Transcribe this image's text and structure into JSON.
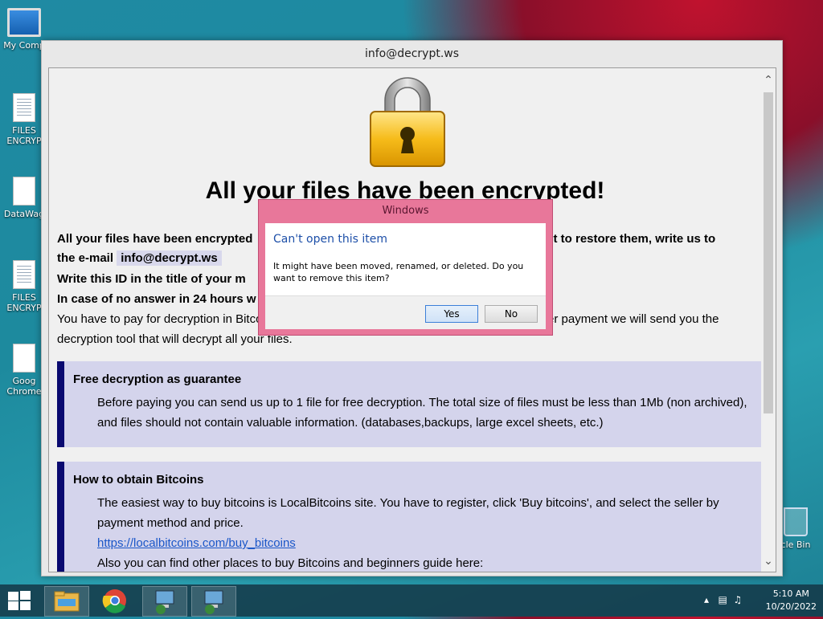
{
  "desktop": {
    "icons": [
      {
        "label": "My Comp"
      },
      {
        "label": "FILES ENCRYP"
      },
      {
        "label": "DataWag"
      },
      {
        "label": "FILES ENCRYP"
      },
      {
        "label": "Goog Chrome"
      }
    ],
    "recycle_bin": "cle Bin"
  },
  "window": {
    "title": "info@decrypt.ws",
    "headline": "All your files have been encrypted!",
    "line1_start": "All your files have been encrypted",
    "line1_end": "ant to restore them, write us to",
    "line2_prefix": "the e-mail",
    "email": "info@decrypt.ws",
    "line3": "Write this ID in the title of your m",
    "line4": "In case of no answer in 24 hours w",
    "line5_start": "You have to pay for decryption in Bitco",
    "line5_end": "er payment we will send you the",
    "line6": "decryption tool that will decrypt all your files.",
    "box1": {
      "title": "Free decryption as guarantee",
      "text": "Before paying you can send us up to 1 file for free decryption. The total size of files must be less than 1Mb (non archived), and files should not contain valuable information. (databases,backups, large excel sheets, etc.)"
    },
    "box2": {
      "title": "How to obtain Bitcoins",
      "text": "The easiest way to buy bitcoins is LocalBitcoins site. You have to register, click 'Buy bitcoins', and select the seller by payment method and price.",
      "link": "https://localbitcoins.com/buy_bitcoins",
      "text2": "Also you can find other places to buy Bitcoins and beginners guide here:"
    }
  },
  "dialog": {
    "title": "Windows",
    "heading": "Can't open this item",
    "message": "It might have been moved, renamed, or deleted. Do you want to remove this item?",
    "yes": "Yes",
    "no": "No"
  },
  "taskbar": {
    "time": "5:10 AM",
    "date": "10/20/2022"
  }
}
